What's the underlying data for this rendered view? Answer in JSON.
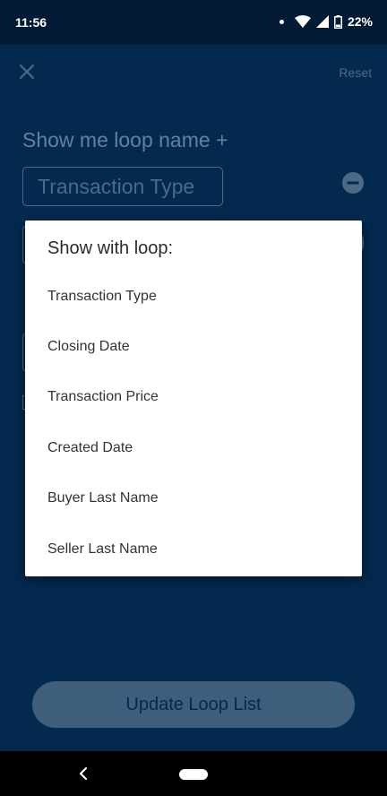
{
  "status_bar": {
    "time": "11:56",
    "battery": "22%",
    "icons": [
      "notification-dot-icon",
      "wifi-icon",
      "signal-icon",
      "battery-icon"
    ]
  },
  "screen": {
    "close_icon": "close-icon",
    "reset_label": "Reset",
    "section_title": "Show me loop name +",
    "selected_chip": "Transaction Type",
    "remove_icon": "remove-circle-icon",
    "update_button_label": "Update Loop List"
  },
  "modal": {
    "title": "Show with loop:",
    "options": [
      "Transaction Type",
      "Closing Date",
      "Transaction Price",
      "Created Date",
      "Buyer Last Name",
      "Seller Last Name"
    ]
  },
  "colors": {
    "background": "#04294f",
    "status_bar": "#021a33",
    "muted_text": "#62819c",
    "button": "#3f5e7c",
    "modal_bg": "#ffffff"
  }
}
